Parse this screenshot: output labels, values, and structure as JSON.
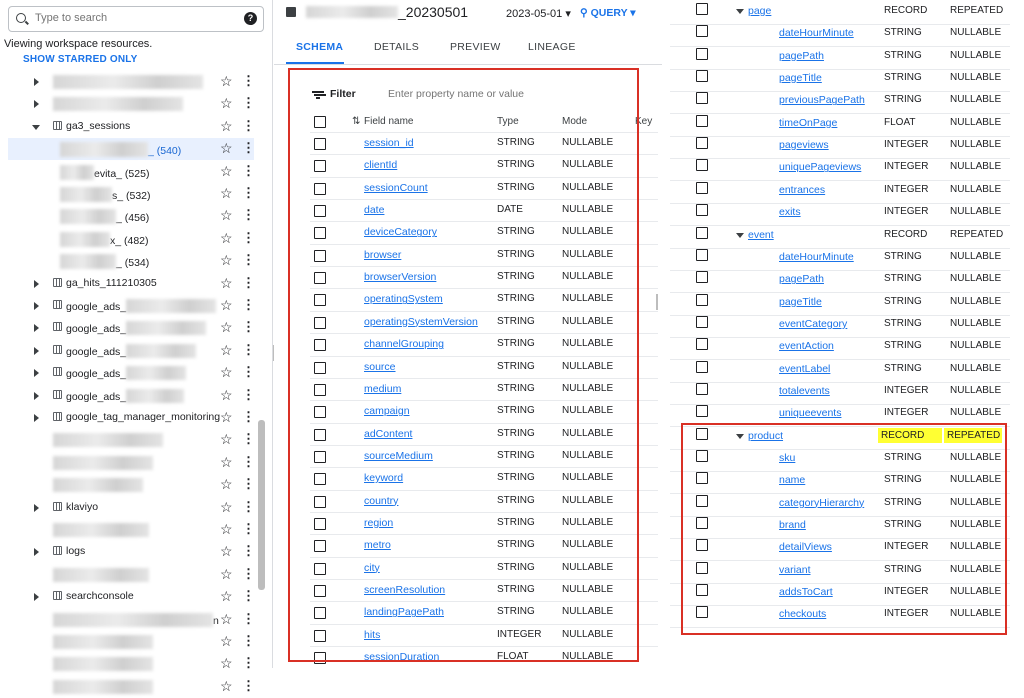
{
  "left": {
    "search_placeholder": "Type to search",
    "viewing_text": "Viewing workspace resources.",
    "show_starred": "SHOW STARRED ONLY",
    "tree": [
      {
        "label": "",
        "expand": "right",
        "ds": false,
        "indent": 0,
        "blur_w": 150,
        "selected": false
      },
      {
        "label": "",
        "expand": "right",
        "ds": false,
        "indent": 0,
        "blur_w": 130,
        "selected": false
      },
      {
        "label": "ga3_sessions",
        "expand": "down",
        "ds": true,
        "indent": 0,
        "selected": false
      },
      {
        "label": "_ (540)",
        "expand": "none",
        "ds": false,
        "indent": 1,
        "blur_w": 88,
        "selected": true
      },
      {
        "label": "evita_ (525)",
        "expand": "none",
        "ds": false,
        "indent": 1,
        "blur_w": 34,
        "selected": false
      },
      {
        "label": "s_ (532)",
        "expand": "none",
        "ds": false,
        "indent": 1,
        "blur_w": 52,
        "selected": false
      },
      {
        "label": "_ (456)",
        "expand": "none",
        "ds": false,
        "indent": 1,
        "blur_w": 56,
        "selected": false
      },
      {
        "label": "x_ (482)",
        "expand": "none",
        "ds": false,
        "indent": 1,
        "blur_w": 50,
        "selected": false
      },
      {
        "label": "_ (534)",
        "expand": "none",
        "ds": false,
        "indent": 1,
        "blur_w": 56,
        "selected": false
      },
      {
        "label": "ga_hits_111210305",
        "expand": "right",
        "ds": true,
        "indent": 0,
        "selected": false
      },
      {
        "label": "google_ads_",
        "expand": "right",
        "ds": true,
        "indent": 0,
        "blur_w": 90,
        "selected": false
      },
      {
        "label": "google_ads_",
        "expand": "right",
        "ds": true,
        "indent": 0,
        "blur_w": 80,
        "selected": false
      },
      {
        "label": "google_ads_",
        "expand": "right",
        "ds": true,
        "indent": 0,
        "blur_w": 70,
        "selected": false
      },
      {
        "label": "google_ads_",
        "expand": "right",
        "ds": true,
        "indent": 0,
        "blur_w": 60,
        "selected": false
      },
      {
        "label": "google_ads_",
        "expand": "right",
        "ds": true,
        "indent": 0,
        "blur_w": 58,
        "selected": false
      },
      {
        "label": "google_tag_manager_monitoring",
        "expand": "right",
        "ds": true,
        "indent": 0,
        "selected": false
      },
      {
        "label": "",
        "expand": "none",
        "ds": false,
        "indent": 0,
        "blur_w": 110,
        "selected": false
      },
      {
        "label": "",
        "expand": "none",
        "ds": false,
        "indent": 0,
        "blur_w": 100,
        "selected": false
      },
      {
        "label": "",
        "expand": "none",
        "ds": false,
        "indent": 0,
        "blur_w": 90,
        "selected": false
      },
      {
        "label": "klaviyo",
        "expand": "right",
        "ds": true,
        "indent": 0,
        "selected": false
      },
      {
        "label": "",
        "expand": "none",
        "ds": false,
        "indent": 0,
        "blur_w": 96,
        "selected": false
      },
      {
        "label": "logs",
        "expand": "right",
        "ds": true,
        "indent": 0,
        "selected": false
      },
      {
        "label": "",
        "expand": "none",
        "ds": false,
        "indent": 0,
        "blur_w": 96,
        "selected": false
      },
      {
        "label": "searchconsole",
        "expand": "right",
        "ds": true,
        "indent": 0,
        "selected": false
      },
      {
        "label": "n",
        "expand": "none",
        "ds": false,
        "indent": 0,
        "blur_w": 160,
        "selected": false
      },
      {
        "label": "",
        "expand": "none",
        "ds": false,
        "indent": 0,
        "blur_w": 100,
        "selected": false
      },
      {
        "label": "",
        "expand": "none",
        "ds": false,
        "indent": 0,
        "blur_w": 100,
        "selected": false
      },
      {
        "label": "",
        "expand": "none",
        "ds": false,
        "indent": 0,
        "blur_w": 100,
        "selected": false
      }
    ]
  },
  "table": {
    "name_suffix": "_20230501",
    "date_select": "2023-05-01",
    "query_label": "QUERY",
    "tabs": [
      "SCHEMA",
      "DETAILS",
      "PREVIEW",
      "LINEAGE"
    ],
    "filter_label": "Filter",
    "filter_placeholder": "Enter property name or value",
    "columns": [
      "Field name",
      "Type",
      "Mode",
      "Key"
    ],
    "fields": [
      {
        "name": "session_id",
        "type": "STRING",
        "mode": "NULLABLE"
      },
      {
        "name": "clientId",
        "type": "STRING",
        "mode": "NULLABLE"
      },
      {
        "name": "sessionCount",
        "type": "STRING",
        "mode": "NULLABLE"
      },
      {
        "name": "date",
        "type": "DATE",
        "mode": "NULLABLE"
      },
      {
        "name": "deviceCategory",
        "type": "STRING",
        "mode": "NULLABLE"
      },
      {
        "name": "browser",
        "type": "STRING",
        "mode": "NULLABLE"
      },
      {
        "name": "browserVersion",
        "type": "STRING",
        "mode": "NULLABLE"
      },
      {
        "name": "operatingSystem",
        "type": "STRING",
        "mode": "NULLABLE"
      },
      {
        "name": "operatingSystemVersion",
        "type": "STRING",
        "mode": "NULLABLE"
      },
      {
        "name": "channelGrouping",
        "type": "STRING",
        "mode": "NULLABLE"
      },
      {
        "name": "source",
        "type": "STRING",
        "mode": "NULLABLE"
      },
      {
        "name": "medium",
        "type": "STRING",
        "mode": "NULLABLE"
      },
      {
        "name": "campaign",
        "type": "STRING",
        "mode": "NULLABLE"
      },
      {
        "name": "adContent",
        "type": "STRING",
        "mode": "NULLABLE"
      },
      {
        "name": "sourceMedium",
        "type": "STRING",
        "mode": "NULLABLE"
      },
      {
        "name": "keyword",
        "type": "STRING",
        "mode": "NULLABLE"
      },
      {
        "name": "country",
        "type": "STRING",
        "mode": "NULLABLE"
      },
      {
        "name": "region",
        "type": "STRING",
        "mode": "NULLABLE"
      },
      {
        "name": "metro",
        "type": "STRING",
        "mode": "NULLABLE"
      },
      {
        "name": "city",
        "type": "STRING",
        "mode": "NULLABLE"
      },
      {
        "name": "screenResolution",
        "type": "STRING",
        "mode": "NULLABLE"
      },
      {
        "name": "landingPagePath",
        "type": "STRING",
        "mode": "NULLABLE"
      },
      {
        "name": "hits",
        "type": "INTEGER",
        "mode": "NULLABLE"
      },
      {
        "name": "sessionDuration",
        "type": "FLOAT",
        "mode": "NULLABLE"
      }
    ]
  },
  "nested": [
    {
      "name": "page",
      "type": "RECORD",
      "mode": "REPEATED",
      "record": true
    },
    {
      "name": "dateHourMinute",
      "type": "STRING",
      "mode": "NULLABLE"
    },
    {
      "name": "pagePath",
      "type": "STRING",
      "mode": "NULLABLE"
    },
    {
      "name": "pageTitle",
      "type": "STRING",
      "mode": "NULLABLE"
    },
    {
      "name": "previousPagePath",
      "type": "STRING",
      "mode": "NULLABLE"
    },
    {
      "name": "timeOnPage",
      "type": "FLOAT",
      "mode": "NULLABLE"
    },
    {
      "name": "pageviews",
      "type": "INTEGER",
      "mode": "NULLABLE"
    },
    {
      "name": "uniquePageviews",
      "type": "INTEGER",
      "mode": "NULLABLE"
    },
    {
      "name": "entrances",
      "type": "INTEGER",
      "mode": "NULLABLE"
    },
    {
      "name": "exits",
      "type": "INTEGER",
      "mode": "NULLABLE"
    },
    {
      "name": "event",
      "type": "RECORD",
      "mode": "REPEATED",
      "record": true
    },
    {
      "name": "dateHourMinute",
      "type": "STRING",
      "mode": "NULLABLE"
    },
    {
      "name": "pagePath",
      "type": "STRING",
      "mode": "NULLABLE"
    },
    {
      "name": "pageTitle",
      "type": "STRING",
      "mode": "NULLABLE"
    },
    {
      "name": "eventCategory",
      "type": "STRING",
      "mode": "NULLABLE"
    },
    {
      "name": "eventAction",
      "type": "STRING",
      "mode": "NULLABLE"
    },
    {
      "name": "eventLabel",
      "type": "STRING",
      "mode": "NULLABLE"
    },
    {
      "name": "totalevents",
      "type": "INTEGER",
      "mode": "NULLABLE"
    },
    {
      "name": "uniqueevents",
      "type": "INTEGER",
      "mode": "NULLABLE"
    },
    {
      "name": "product",
      "type": "RECORD",
      "mode": "REPEATED",
      "record": true,
      "highlight": true
    },
    {
      "name": "sku",
      "type": "STRING",
      "mode": "NULLABLE"
    },
    {
      "name": "name",
      "type": "STRING",
      "mode": "NULLABLE"
    },
    {
      "name": "categoryHierarchy",
      "type": "STRING",
      "mode": "NULLABLE"
    },
    {
      "name": "brand",
      "type": "STRING",
      "mode": "NULLABLE"
    },
    {
      "name": "detailViews",
      "type": "INTEGER",
      "mode": "NULLABLE"
    },
    {
      "name": "variant",
      "type": "STRING",
      "mode": "NULLABLE"
    },
    {
      "name": "addsToCart",
      "type": "INTEGER",
      "mode": "NULLABLE"
    },
    {
      "name": "checkouts",
      "type": "INTEGER",
      "mode": "NULLABLE"
    }
  ],
  "colors": {
    "accent": "#1a73e8",
    "highlight_box": "#d93025",
    "highlight_fill": "#ffff33"
  }
}
